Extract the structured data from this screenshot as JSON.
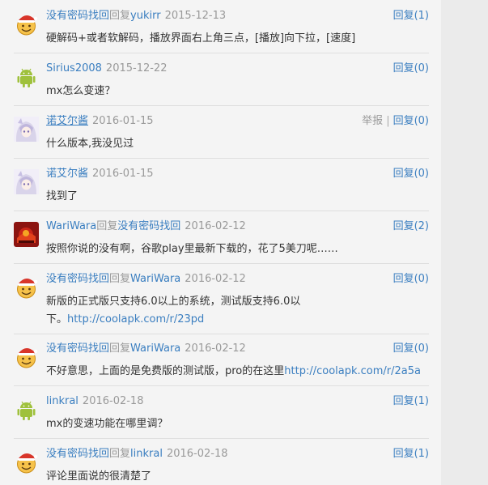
{
  "comments": [
    {
      "user": "没有密码找回",
      "reply_word": "回复",
      "reply_to": "yukirr",
      "date": "2015-12-13",
      "reply": "回复(1)",
      "text": "硬解码+或者软解码，播放界面右上角三点，[播放]向下拉，[速度]",
      "avatar": "santa-emoji-avatar"
    },
    {
      "user": "Sirius2008",
      "date": "2015-12-22",
      "reply": "回复(0)",
      "text": "mx怎么变速？",
      "avatar": "android-robot-avatar"
    },
    {
      "user": "诺艾尔酱",
      "date": "2016-01-15",
      "report": "举报",
      "reply": "回复(0)",
      "text": "什么版本,我没见过",
      "avatar": "anime-girl-avatar"
    },
    {
      "user": "诺艾尔酱",
      "date": "2016-01-15",
      "reply": "回复(0)",
      "text": "找到了",
      "avatar": "anime-girl-avatar"
    },
    {
      "user": "WariWara",
      "reply_word": "回复",
      "reply_to": "没有密码找回",
      "date": "2016-02-12",
      "reply": "回复(2)",
      "text": "按照你说的没有啊，谷歌play里最新下载的，花了5美刀呢……",
      "avatar": "red-game-avatar"
    },
    {
      "user": "没有密码找回",
      "reply_word": "回复",
      "reply_to": "WariWara",
      "date": "2016-02-12",
      "reply": "回复(0)",
      "text_line1": "新版的正式版只支持6.0以上的系统，测试版支持6.0以",
      "text_line2_prefix": "下。",
      "link": "http://coolapk.com/r/23pd",
      "avatar": "santa-emoji-avatar"
    },
    {
      "user": "没有密码找回",
      "reply_word": "回复",
      "reply_to": "WariWara",
      "date": "2016-02-12",
      "reply": "回复(0)",
      "text_prefix": "不好意思，上面的是免费版的测试版，pro的在这里",
      "link": "http://coolapk.com/r/2a5a",
      "avatar": "santa-emoji-avatar"
    },
    {
      "user": "linkral",
      "date": "2016-02-18",
      "reply": "回复(1)",
      "text": "mx的变速功能在哪里调？",
      "avatar": "android-robot-avatar"
    },
    {
      "user": "没有密码找回",
      "reply_word": "回复",
      "reply_to": "linkral",
      "date": "2016-02-18",
      "reply": "回复(1)",
      "text": "评论里面说的很清楚了",
      "avatar": "santa-emoji-avatar"
    }
  ],
  "colors": {
    "link": "#3a7ec0",
    "meta": "#999999",
    "panel": "#f4f4f4",
    "page": "#ebebeb"
  }
}
